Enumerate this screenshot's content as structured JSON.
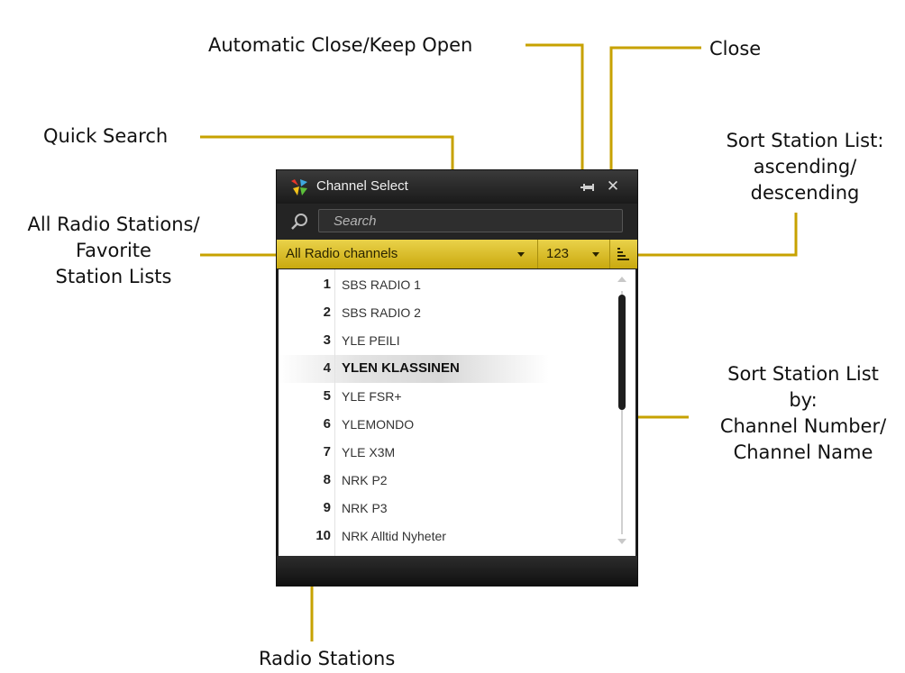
{
  "callouts": {
    "auto_close": "Automatic Close/Keep Open",
    "close": "Close",
    "quick_search": "Quick Search",
    "sort_order": [
      "Sort Station List:",
      "ascending/",
      "descending"
    ],
    "station_lists": [
      "All Radio Stations/",
      "Favorite",
      "Station Lists"
    ],
    "sort_by": [
      "Sort Station List",
      "by:",
      "Channel Number/",
      "Channel Name"
    ],
    "radio_stations": "Radio Stations"
  },
  "window": {
    "title": "Channel Select",
    "close_glyph": "✕",
    "search": {
      "placeholder": "Search",
      "value": ""
    },
    "list_select": "All Radio channels",
    "sort_select": "123",
    "stations": [
      {
        "number": "1",
        "name": "SBS RADIO 1",
        "selected": false
      },
      {
        "number": "2",
        "name": "SBS RADIO 2",
        "selected": false
      },
      {
        "number": "3",
        "name": "YLE PEILI",
        "selected": false
      },
      {
        "number": "4",
        "name": "YLEN KLASSINEN",
        "selected": true
      },
      {
        "number": "5",
        "name": "YLE FSR+",
        "selected": false
      },
      {
        "number": "6",
        "name": "YLEMONDO",
        "selected": false
      },
      {
        "number": "7",
        "name": "YLE X3M",
        "selected": false
      },
      {
        "number": "8",
        "name": "NRK P2",
        "selected": false
      },
      {
        "number": "9",
        "name": "NRK P3",
        "selected": false
      },
      {
        "number": "10",
        "name": "NRK Alltid Nyheter",
        "selected": false
      }
    ]
  },
  "colors": {
    "callout_line": "#c7a200",
    "filter_bar": "#d9bc24",
    "window_dark": "#1c1c1c"
  }
}
